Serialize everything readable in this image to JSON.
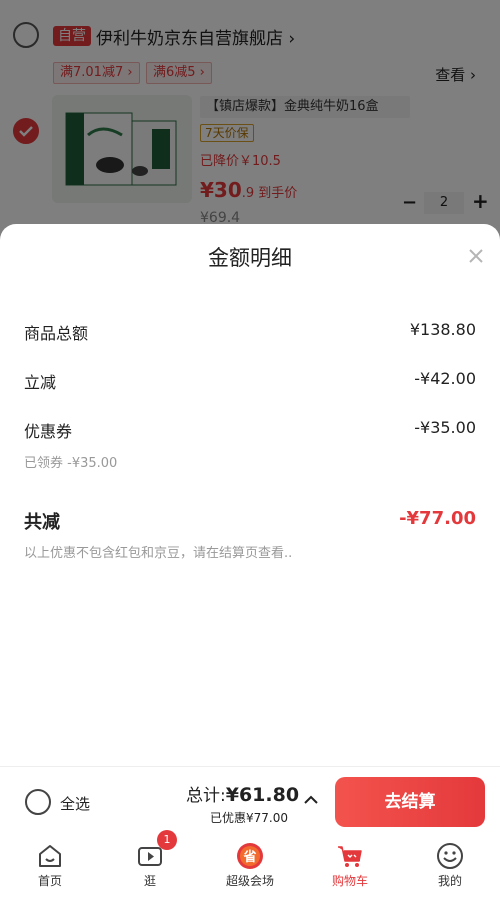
{
  "shop": {
    "badge": "自营",
    "name": "伊利牛奶京东自营旗舰店 ›",
    "promos": [
      "满7.01减7 ›",
      "满6减5 ›"
    ],
    "view_link": "查看 ›"
  },
  "item": {
    "name": "【镇店爆款】金典纯牛奶16盒",
    "warranty": "7天价保",
    "price_drop": "已降价￥10.5",
    "price_big": "¥30",
    "price_small": ".9 到手价",
    "price_old": "¥69.4",
    "quantity": "2"
  },
  "sheet": {
    "title": "金额明细",
    "lines": [
      {
        "label": "商品总额",
        "value": "¥138.80"
      },
      {
        "label": "立减",
        "value": "-¥42.00"
      },
      {
        "label": "优惠券",
        "value": "-¥35.00"
      }
    ],
    "coupon_note": "已领券 -¥35.00",
    "total_label": "共减",
    "total_value": "-¥77.00",
    "disclaimer": "以上优惠不包含红包和京豆，请在结算页查看.."
  },
  "checkout": {
    "select_all": "全选",
    "total_prefix": "总计:",
    "total_amount": "¥61.80",
    "saved": "已优惠¥77.00",
    "button": "去结算"
  },
  "tabs": [
    {
      "label": "首页",
      "icon": "home-icon"
    },
    {
      "label": "逛",
      "icon": "play-icon",
      "badge": "1"
    },
    {
      "label": "超级会场",
      "icon": "super-venue-icon"
    },
    {
      "label": "购物车",
      "icon": "cart-icon",
      "active": true
    },
    {
      "label": "我的",
      "icon": "smiley-icon"
    }
  ],
  "colors": {
    "accent": "#e4393c",
    "overlay": "rgba(0,0,0,0.5)"
  }
}
